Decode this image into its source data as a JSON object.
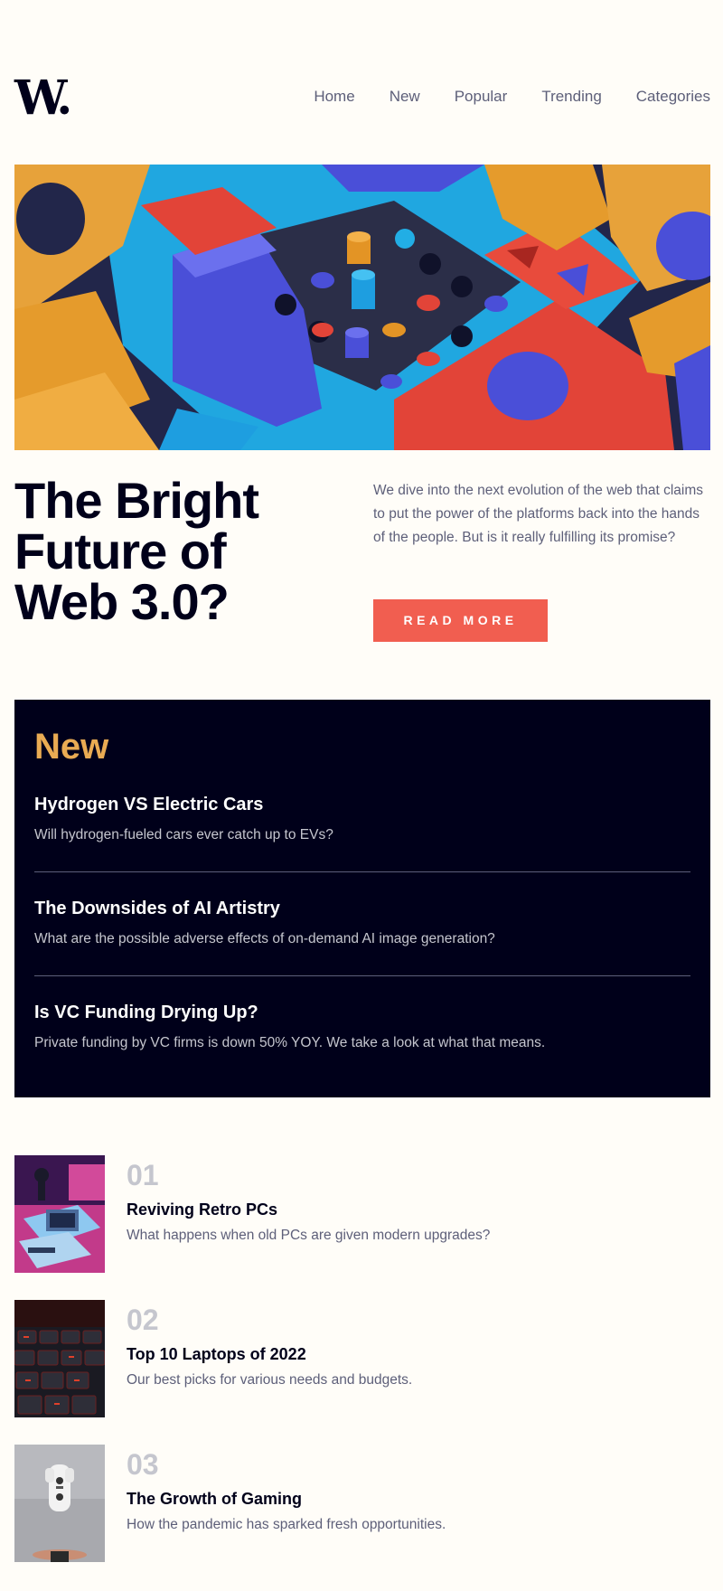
{
  "brand": {
    "logo_text": "W."
  },
  "nav": [
    "Home",
    "New",
    "Popular",
    "Trending",
    "Categories"
  ],
  "hero": {
    "title_lines": [
      "The Bright",
      "Future of",
      "Web 3.0?"
    ],
    "intro": "We dive into the next evolution of the web that claims to put the power of the platforms back into the hands of the people. But is it really fulfilling its promise?",
    "cta_label": "READ MORE"
  },
  "new_panel": {
    "title": "New",
    "items": [
      {
        "title": "Hydrogen VS Electric Cars",
        "desc": "Will hydrogen-fueled cars ever catch up to EVs?"
      },
      {
        "title": "The Downsides of AI Artistry",
        "desc": "What are the possible adverse effects of on-demand AI image generation?"
      },
      {
        "title": "Is VC Funding Drying Up?",
        "desc": "Private funding by VC firms is down 50% YOY. We take a look at what that means."
      }
    ]
  },
  "articles": [
    {
      "num": "01",
      "title": "Reviving Retro PCs",
      "desc": "What happens when old PCs are given modern upgrades?"
    },
    {
      "num": "02",
      "title": "Top 10 Laptops of 2022",
      "desc": "Our best picks for various needs and budgets."
    },
    {
      "num": "03",
      "title": "The Growth of Gaming",
      "desc": "How the pandemic has sparked fresh opportunities."
    }
  ],
  "colors": {
    "background": "#fffdf8",
    "dark": "#00001a",
    "accent_red": "#f15e50",
    "accent_orange": "#e9ab53",
    "gray": "#5d5f79",
    "light_gray": "#c5c6ce"
  }
}
